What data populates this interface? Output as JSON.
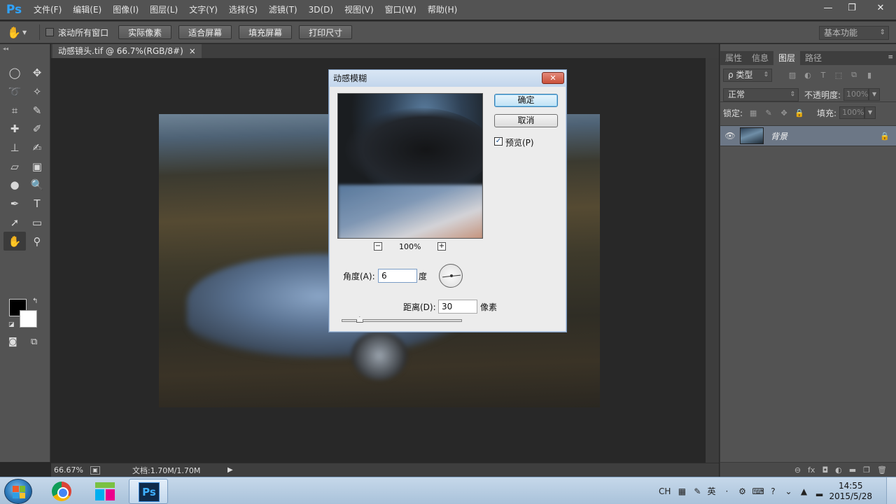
{
  "app": {
    "logo": "Ps",
    "menu": [
      "文件(F)",
      "编辑(E)",
      "图像(I)",
      "图层(L)",
      "文字(Y)",
      "选择(S)",
      "滤镜(T)",
      "3D(D)",
      "视图(V)",
      "窗口(W)",
      "帮助(H)"
    ],
    "window_controls": {
      "minimize": "—",
      "restore": "❐",
      "close": "✕"
    }
  },
  "options_bar": {
    "scroll_all_label": "滚动所有窗口",
    "buttons": [
      "实际像素",
      "适合屏幕",
      "填充屏幕",
      "打印尺寸"
    ],
    "workspace": "基本功能"
  },
  "document": {
    "tab_title": "动感镜头.tif @ 66.7%(RGB/8#)",
    "tab_close": "×"
  },
  "status_bar": {
    "zoom": "66.67%",
    "doc_size": "文档:1.70M/1.70M",
    "arrow": "▶"
  },
  "tools": [
    {
      "name": "marquee",
      "glyph": "◯"
    },
    {
      "name": "move",
      "glyph": "✥"
    },
    {
      "name": "lasso",
      "glyph": "➰"
    },
    {
      "name": "magic-wand",
      "glyph": "✧"
    },
    {
      "name": "crop",
      "glyph": "⌗"
    },
    {
      "name": "eyedropper",
      "glyph": "✎"
    },
    {
      "name": "healing-brush",
      "glyph": "✚"
    },
    {
      "name": "brush",
      "glyph": "✐"
    },
    {
      "name": "clone-stamp",
      "glyph": "⊥"
    },
    {
      "name": "history-brush",
      "glyph": "✍"
    },
    {
      "name": "eraser",
      "glyph": "▱"
    },
    {
      "name": "gradient",
      "glyph": "▣"
    },
    {
      "name": "blur",
      "glyph": "●"
    },
    {
      "name": "dodge",
      "glyph": "🔍"
    },
    {
      "name": "pen",
      "glyph": "✒"
    },
    {
      "name": "type",
      "glyph": "T"
    },
    {
      "name": "path-selection",
      "glyph": "➚"
    },
    {
      "name": "rectangle",
      "glyph": "▭"
    },
    {
      "name": "hand",
      "glyph": "✋",
      "active": true
    },
    {
      "name": "zoom",
      "glyph": "⚲"
    }
  ],
  "panels": {
    "tabs": [
      "属性",
      "信息",
      "图层",
      "路径"
    ],
    "active_tab": "图层",
    "filter_kind": "ρ 类型",
    "blend_mode": "正常",
    "opacity_label": "不透明度:",
    "opacity_value": "100%",
    "lock_label": "锁定:",
    "fill_label": "填充:",
    "fill_value": "100%",
    "layer_name": "背景",
    "bottom_icons": [
      "⊖",
      "fx",
      "◘",
      "◐",
      "▬",
      "❐",
      "🗑"
    ]
  },
  "dialog": {
    "title": "动感模糊",
    "ok": "确定",
    "cancel": "取消",
    "preview_label": "预览(P)",
    "preview_checked": "✓",
    "zoom_minus": "−",
    "zoom_plus": "+",
    "zoom": "100%",
    "angle_label": "角度(A):",
    "angle_value": "6",
    "angle_unit": "度",
    "distance_label": "距离(D):",
    "distance_value": "30",
    "distance_unit": "像素",
    "distance_slider_fraction": 0.15
  },
  "taskbar": {
    "lang": "CH",
    "ime": "英",
    "time": "14:55",
    "date": "2015/5/28"
  }
}
